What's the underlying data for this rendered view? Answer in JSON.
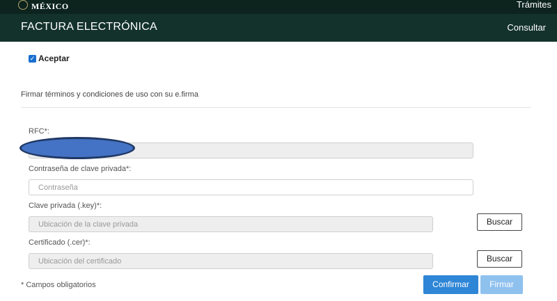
{
  "header": {
    "brand": "MÉXICO",
    "top_link": "Trámites",
    "section_title": "FACTURA ELECTRÓNICA",
    "nav_link": "Consultar"
  },
  "form": {
    "accept_label": "Aceptar",
    "accept_checked": true,
    "terms_text": "Firmar términos y condiciones de uso con su e.firma",
    "rfc_label": "RFC*:",
    "rfc_value": "",
    "password_label": "Contraseña de clave privada*:",
    "password_placeholder": "Contraseña",
    "key_label": "Clave privada (.key)*:",
    "key_placeholder": "Ubicación de la clave privada",
    "cert_label": "Certificado (.cer)*:",
    "cert_placeholder": "Ubicación del certificado",
    "browse_label": "Buscar",
    "required_note": "* Campos obligatorios",
    "confirm_label": "Confirmar",
    "sign_label": "Firmar"
  },
  "colors": {
    "topbar": "#0c231e",
    "subbar": "#13322b",
    "primary_button": "#2f86d6",
    "disabled_button": "#8fc1ee",
    "redaction": "#4472c4"
  }
}
